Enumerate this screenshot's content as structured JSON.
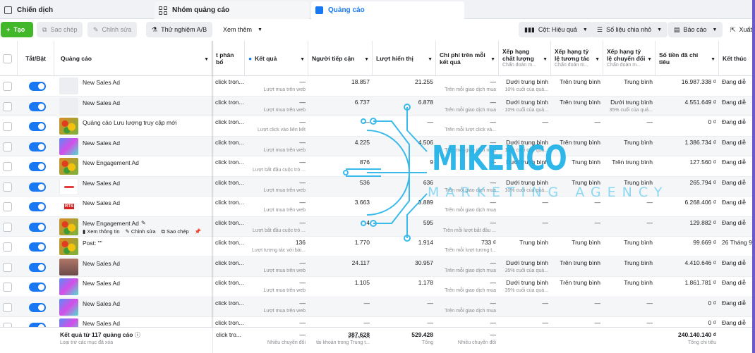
{
  "tabs": [
    {
      "label": "Chiến dịch"
    },
    {
      "label": "Nhóm quảng cáo"
    },
    {
      "label": "Quảng cáo"
    }
  ],
  "toolbar": {
    "create": "Tạo",
    "duplicate": "Sao chép",
    "edit": "Chỉnh sửa",
    "ab_test": "Thử nghiệm A/B",
    "more": "Xem thêm",
    "columns": "Cột: Hiệu quả",
    "breakdown": "Số liệu chia nhỏ",
    "reports": "Báo cáo",
    "export": "Xuất"
  },
  "headers": {
    "onoff": "Tắt/Bật",
    "ad": "Quảng cáo",
    "delivery": "t phân bổ",
    "results": "Kết quả",
    "reach": "Người tiếp cận",
    "impressions": "Lượt hiển thị",
    "cpr": "Chi phí trên mỗi kết quả",
    "quality": "Xếp hạng chất lượng",
    "quality_sub": "Chẩn đoán m...",
    "engagement": "Xếp hạng tỷ lệ tương tác",
    "engagement_sub": "Chẩn đoán m...",
    "conversion": "Xếp hạng tỷ lệ chuyển đổi",
    "conversion_sub": "Chẩn đoán m...",
    "spent": "Số tiền đã chi tiêu",
    "ends": "Kết thúc"
  },
  "row_actions": {
    "view": "Xem thông tin",
    "edit": "Chỉnh sửa",
    "dup": "Sao chép"
  },
  "rows": [
    {
      "name": "New Sales Ad",
      "delivery": "click tron...",
      "result": "—",
      "result_sub": "Lượt mua trên web",
      "reach": "18.857",
      "impr": "21.255",
      "cpr": "—",
      "cpr_sub": "Trên mỗi giao dịch mua",
      "q": "Dưới trung bình",
      "q_sub": "10% cuối của quả...",
      "e": "Trên trung bình",
      "e_sub": "",
      "cv": "Trung bình",
      "cv_sub": "",
      "spent": "16.987.338 ₫",
      "end": "Đang diễ"
    },
    {
      "name": "New Sales Ad",
      "delivery": "click tron...",
      "result": "—",
      "result_sub": "Lượt mua trên web",
      "reach": "6.737",
      "impr": "6.878",
      "cpr": "—",
      "cpr_sub": "Trên mỗi giao dịch mua",
      "q": "Dưới trung bình",
      "q_sub": "10% cuối của quả...",
      "e": "Trên trung bình",
      "e_sub": "",
      "cv": "Dưới trung bình",
      "cv_sub": "35% cuối của quả...",
      "spent": "4.551.649 ₫",
      "end": "Đang diễ"
    },
    {
      "name": "Quảng cáo Lưu lượng truy cập mới",
      "delivery": "click tron...",
      "result": "—",
      "result_sub": "Lượt click vào liên kết",
      "reach": "—",
      "impr": "—",
      "cpr": "—",
      "cpr_sub": "Trên mỗi lượt click và...",
      "q": "—",
      "q_sub": "",
      "e": "—",
      "e_sub": "",
      "cv": "—",
      "cv_sub": "",
      "spent": "0 ₫",
      "end": "Đang diễ"
    },
    {
      "name": "New Sales Ad",
      "delivery": "click tron...",
      "result": "—",
      "result_sub": "Lượt mua trên web",
      "reach": "4.225",
      "impr": "4.506",
      "cpr": "—",
      "cpr_sub": "Trên mỗi giao dịch mua",
      "q": "Dưới trung bình",
      "q_sub": "10% cuối của quả...",
      "e": "Trên trung bình",
      "e_sub": "",
      "cv": "Trung bình",
      "cv_sub": "",
      "spent": "1.386.734 ₫",
      "end": "Đang diễ"
    },
    {
      "name": "New Engagement Ad",
      "delivery": "click tron...",
      "result": "—",
      "result_sub": "Lượt bắt đầu cuộc trò ...",
      "reach": "876",
      "impr": "9",
      "cpr": "—",
      "cpr_sub": "",
      "q": "Dưới trung bình",
      "q_sub": "",
      "e": "Trung bình",
      "e_sub": "",
      "cv": "Trên trung bình",
      "cv_sub": "",
      "spent": "127.560 ₫",
      "end": "Đang diễ"
    },
    {
      "name": "New Sales Ad",
      "delivery": "click tron...",
      "result": "—",
      "result_sub": "Lượt mua trên web",
      "reach": "536",
      "impr": "636",
      "cpr": "—",
      "cpr_sub": "Trên mỗi giao dịch mua",
      "q": "Dưới trung bình",
      "q_sub": "10% cuối của quả...",
      "e": "Trung bình",
      "e_sub": "",
      "cv": "Trung bình",
      "cv_sub": "",
      "spent": "265.794 ₫",
      "end": "Đang diễ"
    },
    {
      "name": "New Sales Ad",
      "delivery": "click tron...",
      "result": "—",
      "result_sub": "Lượt mua trên web",
      "reach": "3.663",
      "impr": "3.889",
      "cpr": "—",
      "cpr_sub": "Trên mỗi giao dịch mua",
      "q": "—",
      "q_sub": "",
      "e": "—",
      "e_sub": "",
      "cv": "—",
      "cv_sub": "",
      "spent": "6.268.406 ₫",
      "end": "Đang diễ"
    },
    {
      "name": "New Engagement Ad",
      "delivery": "click tron...",
      "result": "—",
      "result_sub": "Lượt bắt đầu cuộc trò ...",
      "reach": "4",
      "impr": "595",
      "cpr": "—",
      "cpr_sub": "Trên mỗi lượt bắt đầu ...",
      "q": "—",
      "q_sub": "",
      "e": "—",
      "e_sub": "",
      "cv": "—",
      "cv_sub": "",
      "spent": "129.882 ₫",
      "end": "Đang diễ"
    },
    {
      "name": "Post: \"\"",
      "delivery": "click tron...",
      "result": "136",
      "result_sub": "Lượt tương tác với bài...",
      "reach": "1.770",
      "impr": "1.914",
      "cpr": "733 ₫",
      "cpr_sub": "Trên mỗi lượt tương t...",
      "q": "Trung bình",
      "q_sub": "",
      "e": "Trung bình",
      "e_sub": "",
      "cv": "Trung bình",
      "cv_sub": "",
      "spent": "99.669 ₫",
      "end": "26 Tháng 9,"
    },
    {
      "name": "New Sales Ad",
      "delivery": "click tron...",
      "result": "—",
      "result_sub": "Lượt mua trên web",
      "reach": "24.117",
      "impr": "30.957",
      "cpr": "—",
      "cpr_sub": "Trên mỗi giao dịch mua",
      "q": "Dưới trung bình",
      "q_sub": "35% cuối của quả...",
      "e": "Trên trung bình",
      "e_sub": "",
      "cv": "Trung bình",
      "cv_sub": "",
      "spent": "4.410.646 ₫",
      "end": "Đang diễ"
    },
    {
      "name": "New Sales Ad",
      "delivery": "click tron...",
      "result": "—",
      "result_sub": "Lượt mua trên web",
      "reach": "1.105",
      "impr": "1.178",
      "cpr": "—",
      "cpr_sub": "Trên mỗi giao dịch mua",
      "q": "Dưới trung bình",
      "q_sub": "35% cuối của quả...",
      "e": "Trên trung bình",
      "e_sub": "",
      "cv": "Trung bình",
      "cv_sub": "",
      "spent": "1.861.781 ₫",
      "end": "Đang diễ"
    },
    {
      "name": "New Sales Ad",
      "delivery": "click tron...",
      "result": "—",
      "result_sub": "Lượt mua trên web",
      "reach": "—",
      "impr": "—",
      "cpr": "—",
      "cpr_sub": "Trên mỗi giao dịch mua",
      "q": "—",
      "q_sub": "",
      "e": "—",
      "e_sub": "",
      "cv": "—",
      "cv_sub": "",
      "spent": "0 ₫",
      "end": "Đang diễ"
    },
    {
      "name": "New Sales Ad",
      "delivery": "click tron...",
      "result": "—",
      "result_sub": "",
      "reach": "—",
      "impr": "—",
      "cpr": "—",
      "cpr_sub": "",
      "q": "—",
      "q_sub": "",
      "e": "—",
      "e_sub": "",
      "cv": "—",
      "cv_sub": "",
      "spent": "0 ₫",
      "end": "Đang diễ"
    }
  ],
  "footer": {
    "title": "Kết quả từ 117 quảng cáo",
    "sub": "Loại trừ các mục đã xóa",
    "delivery": "click tro...",
    "result": "—",
    "result_sub": "Nhiều chuyển đổi",
    "reach": "387.628",
    "reach_sub": "tài khoản trong Trung t...",
    "impr": "529.428",
    "impr_sub": "Tổng",
    "cpr": "—",
    "cpr_sub": "Nhiều chuyển đổi",
    "spent": "240.140.140 ₫",
    "spent_sub": "Tổng chi tiêu"
  },
  "watermark": {
    "title": "MIKENCO",
    "subtitle": "MARKETING AGENCY",
    "color": "#1ab0e8"
  },
  "colors": {
    "accent": "#1877f2",
    "create": "#42b72a"
  }
}
